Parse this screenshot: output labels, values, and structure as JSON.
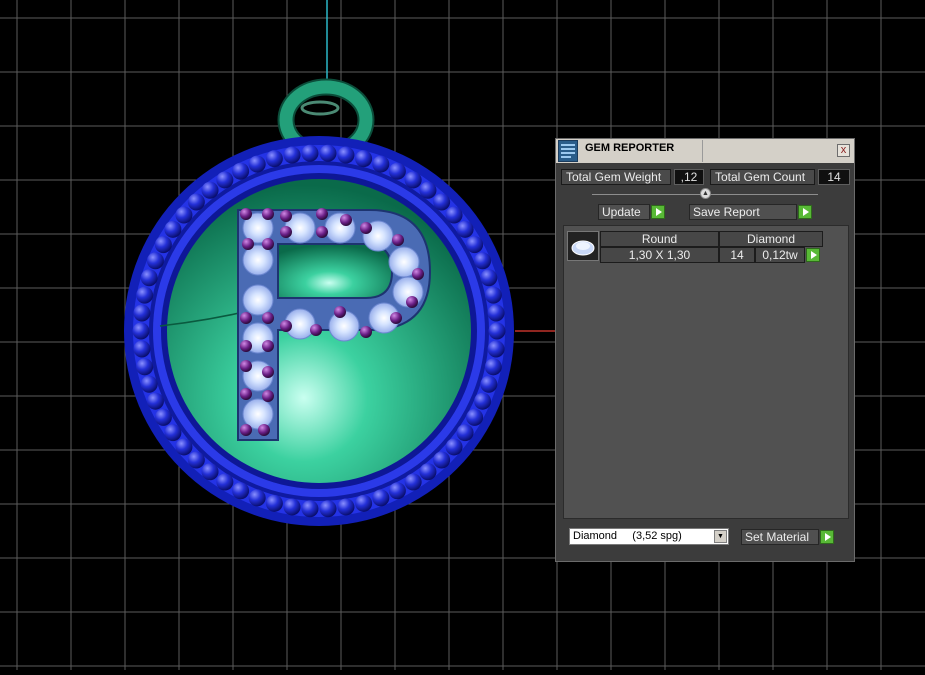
{
  "panel": {
    "title": "GEM REPORTER",
    "close_label": "x",
    "total_gem_weight_label": "Total Gem Weight",
    "total_gem_weight_value": ",12",
    "total_gem_count_label": "Total Gem Count",
    "total_gem_count_value": "14",
    "update_label": "Update",
    "save_report_label": "Save Report",
    "row": {
      "shape": "Round",
      "material": "Diamond",
      "size": "1,30 X 1,30",
      "count": "14",
      "weight": "0,12tw"
    },
    "material_select_value": "Diamond     (3,52 spg)",
    "set_material_label": "Set Material"
  },
  "colors": {
    "background": "#000000",
    "grid": "#5c5c5c",
    "pendant_blue": "#2b37e0",
    "pendant_green": "#1fa97a",
    "gem_purple": "#7a2a8c",
    "accent_green": "#58b936"
  }
}
